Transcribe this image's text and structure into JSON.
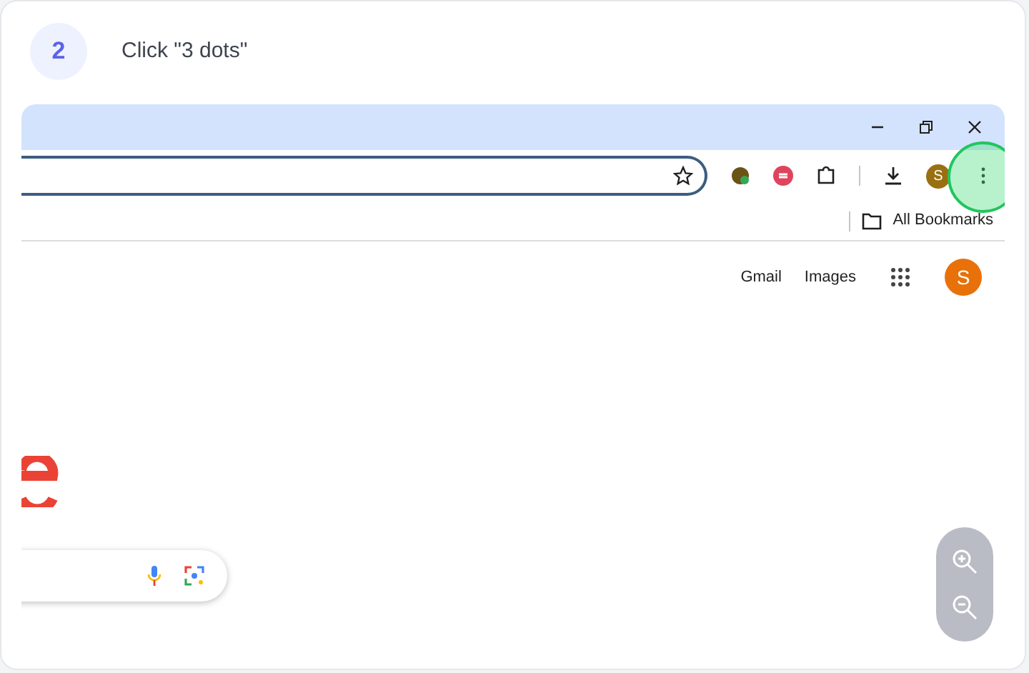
{
  "step": {
    "number": "2",
    "instruction": "Click \"3 dots\""
  },
  "browser": {
    "bookmarks": [
      "All Bookmarks"
    ],
    "profile_initial": "S"
  },
  "page": {
    "links": [
      "Gmail",
      "Images"
    ],
    "avatar_initial": "S"
  }
}
